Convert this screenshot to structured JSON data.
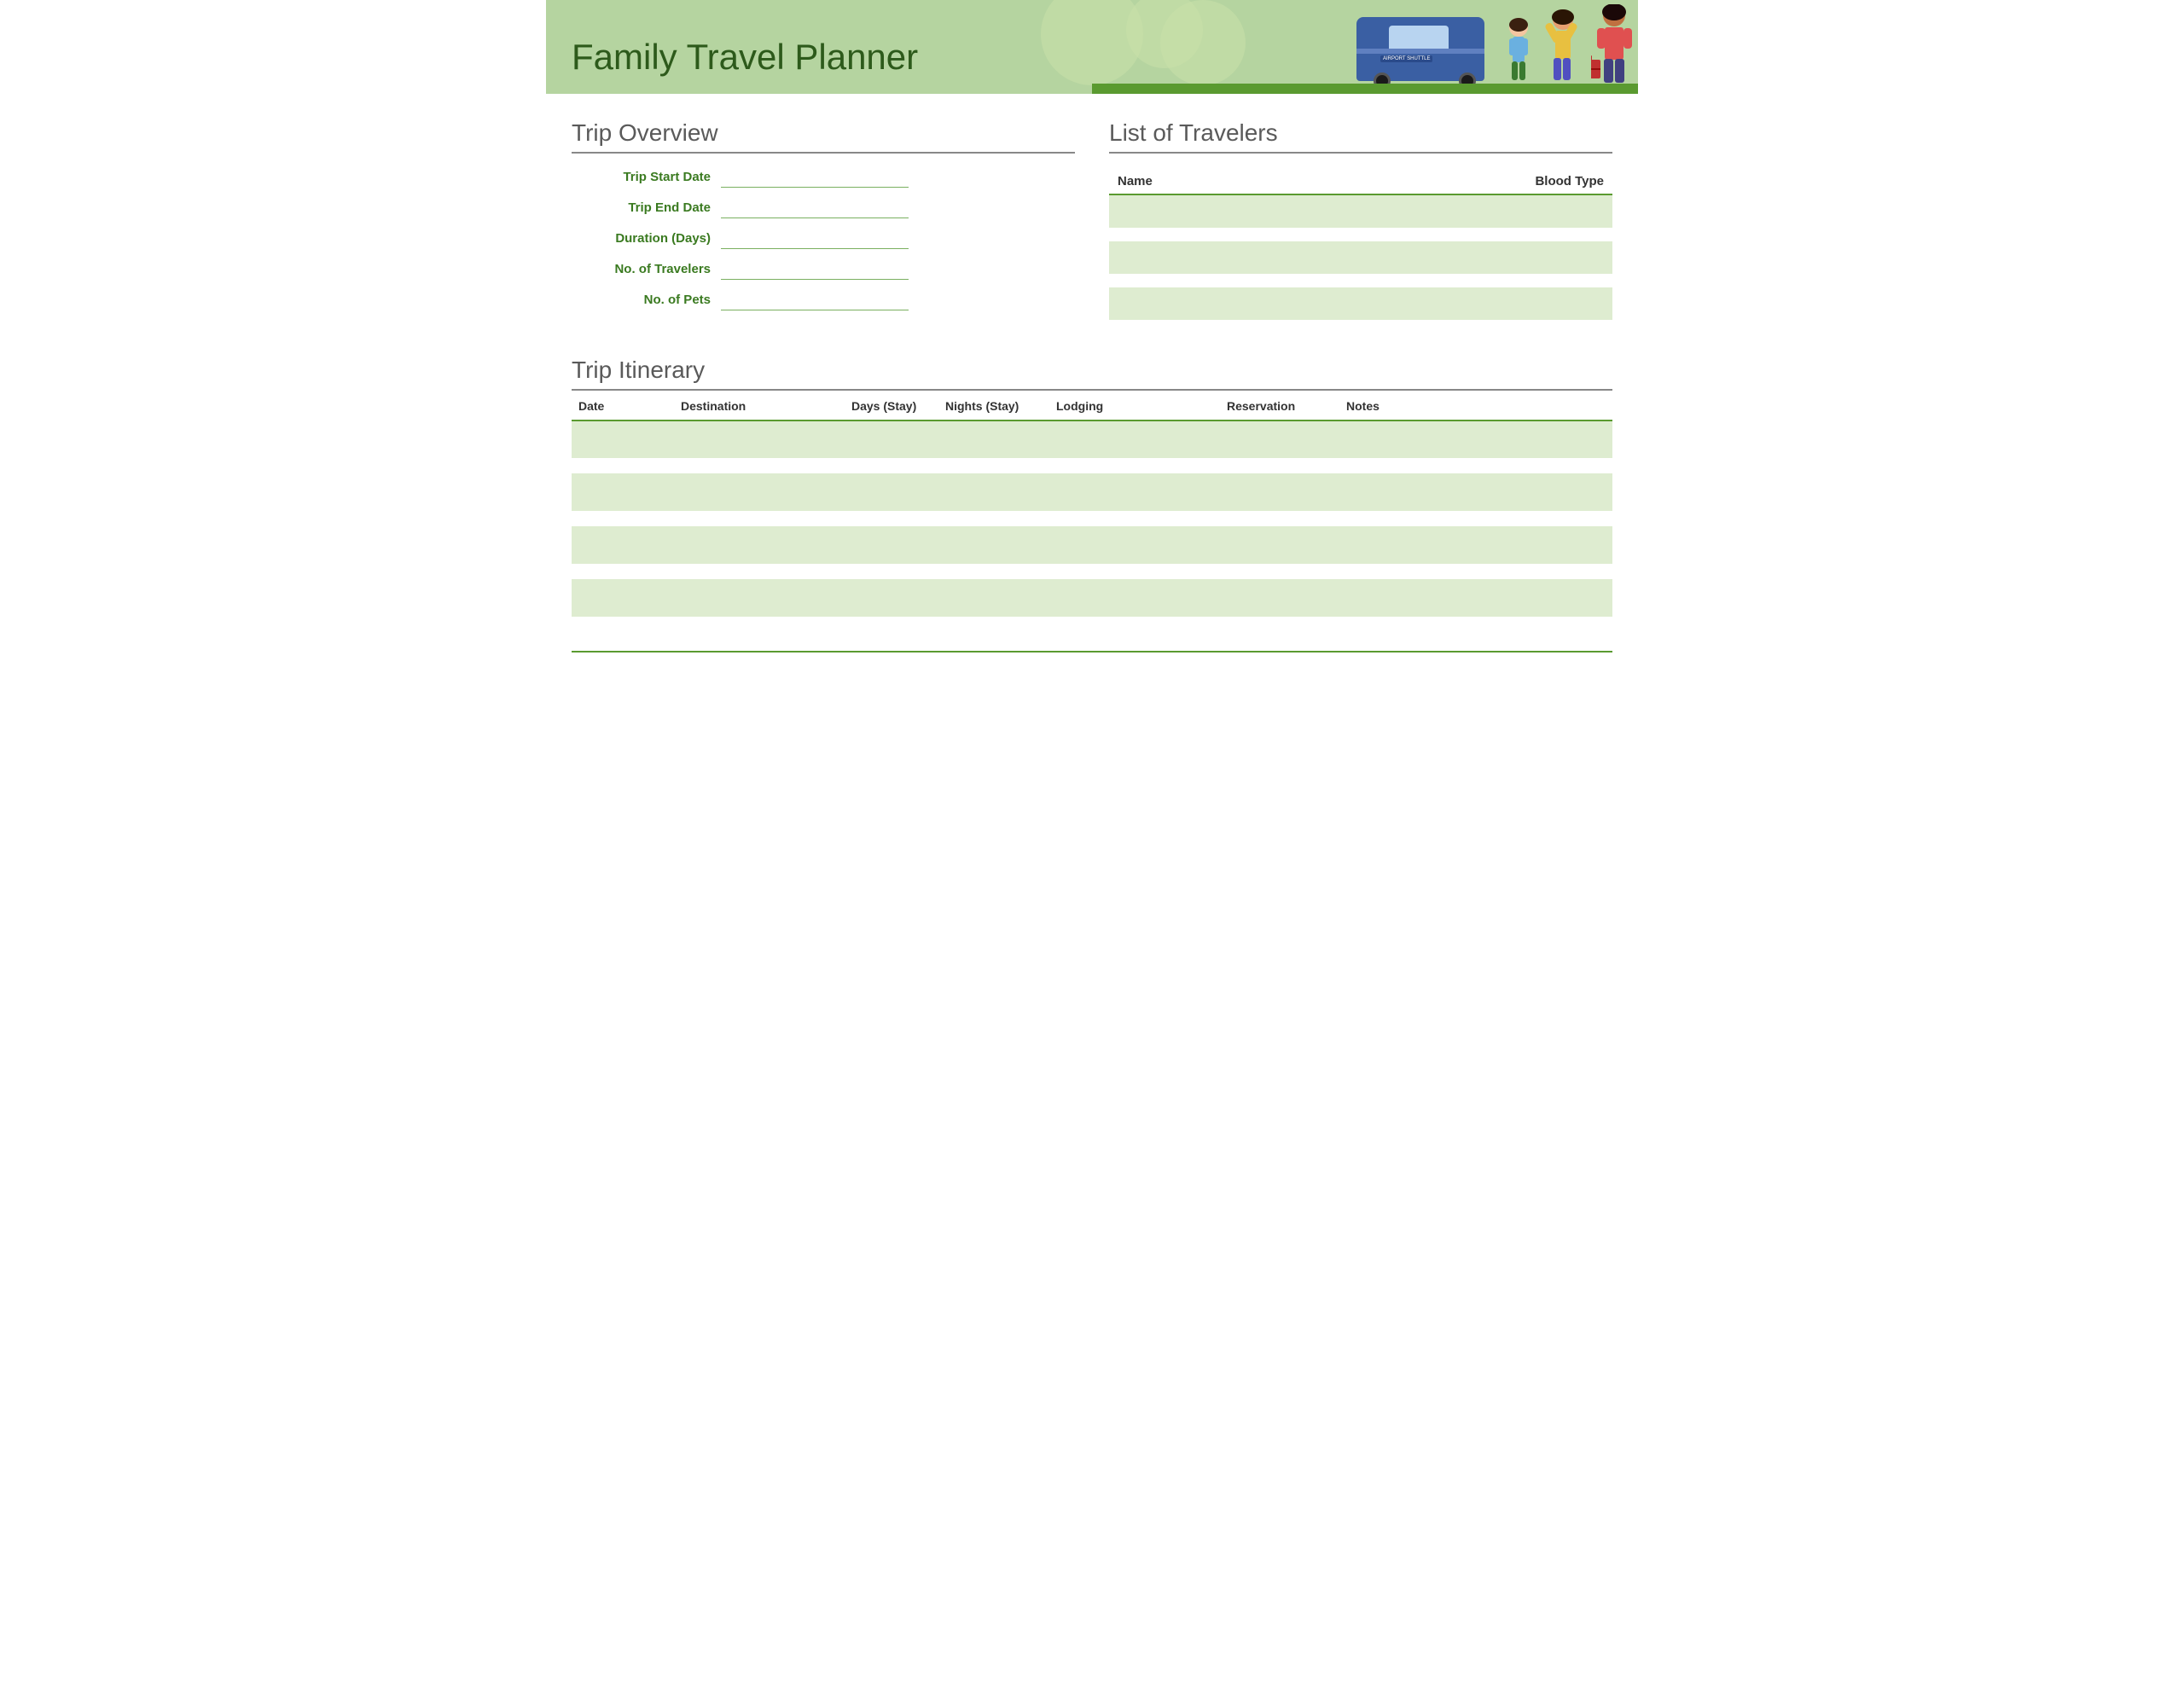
{
  "header": {
    "title": "Family Travel Planner",
    "bus_label": "AIRPORT SHUTTLE"
  },
  "trip_overview": {
    "section_title": "Trip Overview",
    "fields": [
      {
        "label": "Trip Start Date",
        "id": "trip-start-date"
      },
      {
        "label": "Trip End Date",
        "id": "trip-end-date"
      },
      {
        "label": "Duration (Days)",
        "id": "duration-days"
      },
      {
        "label": "No. of Travelers",
        "id": "num-travelers"
      },
      {
        "label": "No. of Pets",
        "id": "num-pets"
      }
    ]
  },
  "travelers": {
    "section_title": "List of Travelers",
    "columns": [
      "Name",
      "Blood Type"
    ],
    "rows": 3
  },
  "itinerary": {
    "section_title": "Trip Itinerary",
    "columns": [
      "Date",
      "Destination",
      "Days (Stay)",
      "Nights (Stay)",
      "Lodging",
      "Reservation",
      "Notes"
    ],
    "rows": 4
  }
}
